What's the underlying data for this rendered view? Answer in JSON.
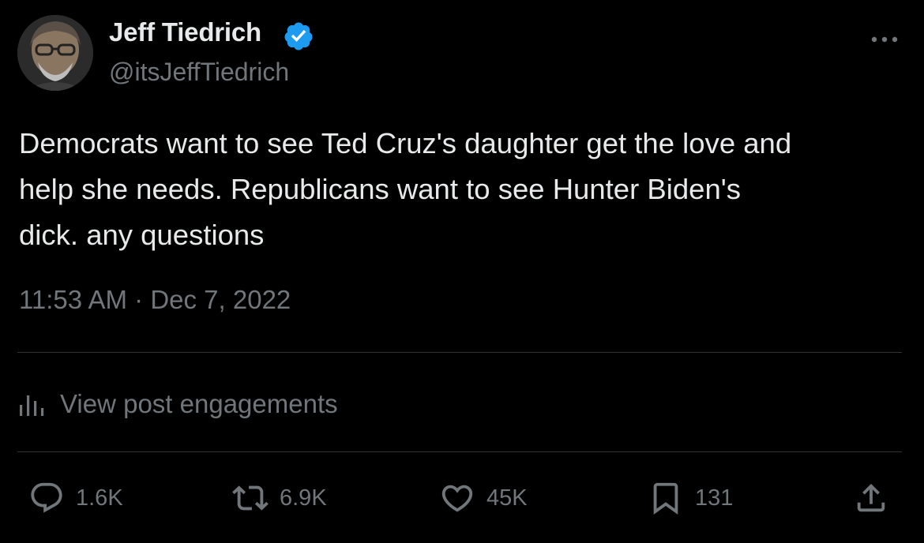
{
  "author": {
    "display_name": "Jeff Tiedrich",
    "handle": "@itsJeffTiedrich",
    "verified_color": "#1d9bf0"
  },
  "tweet": {
    "lines": [
      "Democrats want to see Ted Cruz's daughter get the love and",
      "help she needs. Republicans want to see Hunter Biden's",
      "dick. any questions"
    ],
    "time": "11:53 AM",
    "separator": "·",
    "date": "Dec 7, 2022"
  },
  "engagements_label": "View post engagements",
  "actions": {
    "replies": "1.6K",
    "reposts": "6.9K",
    "likes": "45K",
    "bookmarks": "131"
  },
  "icons": {
    "more": "more-dots-icon",
    "engagements": "bar-chart-icon",
    "reply": "reply-bubble-icon",
    "repost": "repost-arrows-icon",
    "like": "heart-icon",
    "bookmark": "bookmark-icon",
    "share": "share-upload-icon"
  },
  "colors": {
    "background": "#000000",
    "text": "#e7e9ea",
    "muted": "#71767b",
    "divider": "#2f3336"
  }
}
